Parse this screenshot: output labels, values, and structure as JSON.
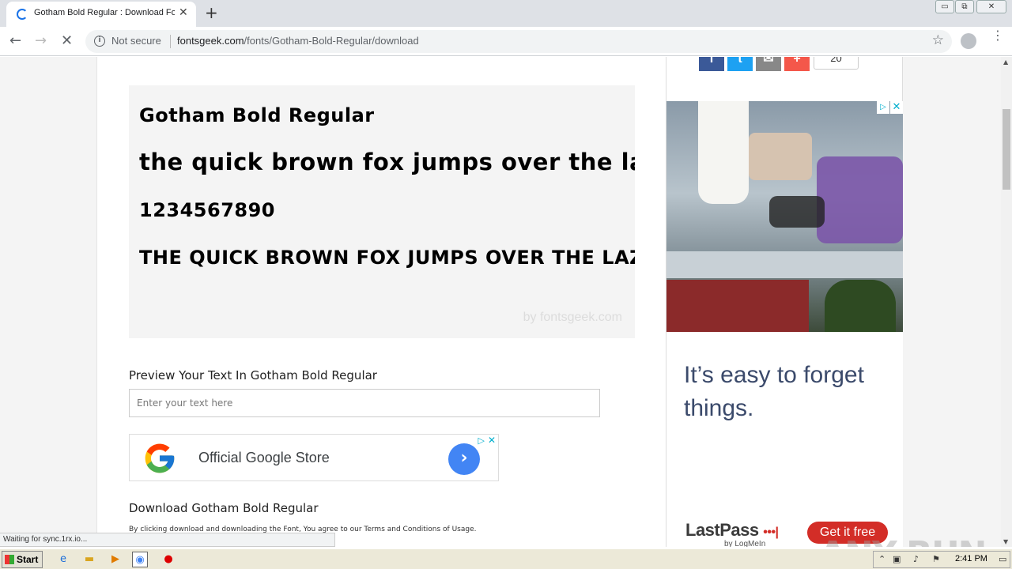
{
  "browser": {
    "tab": {
      "title": "Gotham Bold Regular : Download For",
      "close_icon": "✕"
    },
    "new_tab_icon": "+",
    "window_controls": {
      "minimize": "▭",
      "restore": "⧉",
      "close": "✕"
    },
    "omnibox": {
      "security_label": "Not secure",
      "url_domain": "fontsgeek.com",
      "url_path": "/fonts/Gotham-Bold-Regular/download"
    },
    "status_text": "Waiting for sync.1rx.io..."
  },
  "page": {
    "preview": {
      "font_name": "Gotham Bold Regular",
      "lowercase_sample": "the quick brown fox jumps over the lazy dog",
      "numbers_sample": "1234567890",
      "uppercase_sample": "THE QUICK BROWN FOX JUMPS OVER THE LAZY DOG",
      "credit": "by fontsgeek.com"
    },
    "preview_text": {
      "label": "Preview Your Text In Gotham Bold Regular",
      "placeholder": "Enter your text here"
    },
    "google_ad": {
      "text": "Official Google Store",
      "arrow": "›"
    },
    "download": {
      "heading": "Download Gotham Bold Regular",
      "terms": "By clicking download and downloading the Font, You agree to our Terms and Conditions of Usage."
    }
  },
  "sidebar": {
    "share": {
      "facebook": "f",
      "twitter": "t",
      "email": "✉",
      "more": "+",
      "count": "20"
    },
    "lastpass_ad": {
      "headline": "It’s easy to forget things.",
      "logo": "LastPass",
      "logo_dots": "•••|",
      "byline": "by LogMeIn",
      "cta": "Get it free"
    }
  },
  "watermark": "ANY RUN",
  "taskbar": {
    "start_label": "Start",
    "clock": "2:41 PM"
  },
  "colors": {
    "facebook": "#3b5998",
    "twitter": "#1da1f2",
    "email": "#888888",
    "more": "#f4574a",
    "lastpass_red": "#d32d27"
  }
}
